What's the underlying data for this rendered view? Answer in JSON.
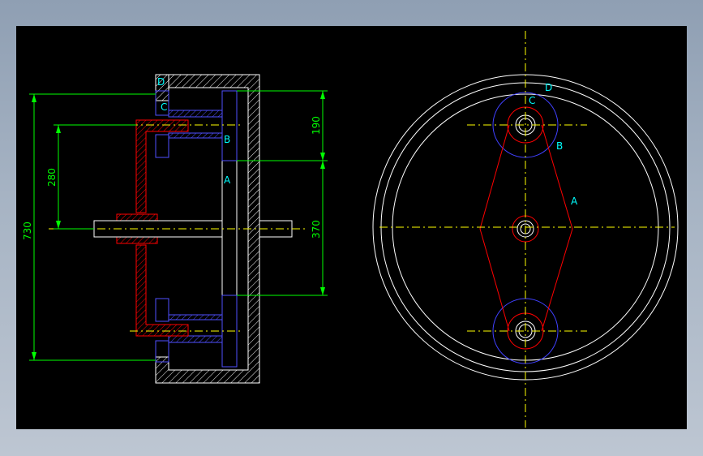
{
  "drawing": {
    "colors": {
      "background": "#000000",
      "outline": "#ffffff",
      "dimension": "#00ff00",
      "centerline": "#ffff00",
      "arm": "#ff0000",
      "circle_b": "#4040ff",
      "label": "#00ffff",
      "hatch": "#ffffff"
    },
    "section_labels": {
      "a": "A",
      "b": "B",
      "c": "C",
      "d": "D"
    },
    "dimensions": {
      "overall": "730",
      "offset": "280",
      "upper": "190",
      "lower": "370"
    },
    "front_labels": {
      "a": "A",
      "b": "B",
      "c": "C",
      "d": "D"
    }
  }
}
